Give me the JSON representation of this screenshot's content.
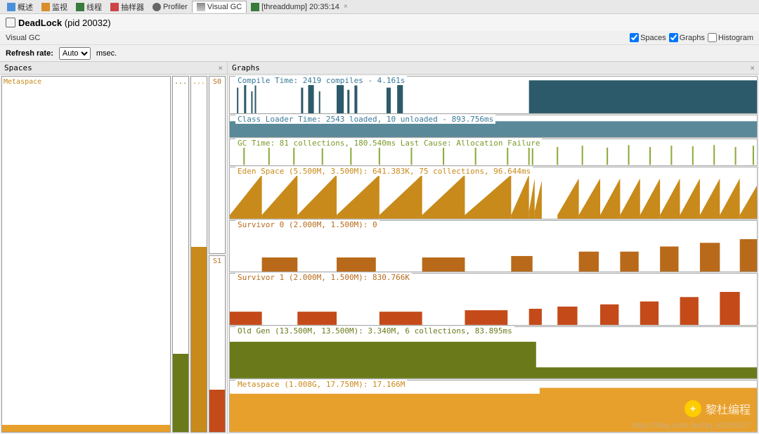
{
  "tabs": [
    {
      "label": "概述",
      "icon": "overview-icon"
    },
    {
      "label": "监视",
      "icon": "monitor-icon"
    },
    {
      "label": "线程",
      "icon": "threads-icon"
    },
    {
      "label": "抽样器",
      "icon": "sampler-icon"
    },
    {
      "label": "Profiler",
      "icon": "profiler-icon"
    },
    {
      "label": "Visual GC",
      "icon": "visualgc-icon",
      "active": true
    },
    {
      "label": "[threaddump] 20:35:14",
      "icon": "threaddump-icon",
      "closable": true
    }
  ],
  "title": {
    "app": "DeadLock",
    "pid_label": "(pid 20032)"
  },
  "subtitle": "Visual GC",
  "checkboxes": {
    "spaces": {
      "label": "Spaces",
      "checked": true
    },
    "graphs": {
      "label": "Graphs",
      "checked": true
    },
    "histogram": {
      "label": "Histogram",
      "checked": false
    }
  },
  "refresh": {
    "label": "Refresh rate:",
    "value": "Auto",
    "unit": "msec."
  },
  "spaces_panel": {
    "title": "Spaces"
  },
  "graphs_panel": {
    "title": "Graphs"
  },
  "spaces": {
    "metaspace": {
      "label": "Metaspace",
      "color": "#e8a02c",
      "fill_pct": 2
    },
    "old": {
      "label": "...",
      "color": "#6a7a1a",
      "fill_pct": 22
    },
    "eden": {
      "label": "...",
      "color": "#c88a1a",
      "fill_pct": 52
    },
    "s0": {
      "label": "S0",
      "color": "#b86a1a",
      "fill_pct": 0
    },
    "s1": {
      "label": "S1",
      "color": "#c44a1a",
      "fill_pct": 12
    }
  },
  "graphs": {
    "compile": {
      "label": "Compile Time: 2419 compiles - 4.161s",
      "color": "#2d5a6a"
    },
    "classloader": {
      "label": "Class Loader Time: 2543 loaded, 10 unloaded - 893.756ms",
      "color": "#5a8a9a"
    },
    "gc": {
      "label": "GC Time: 81 collections, 180.540ms Last Cause: Allocation Failure",
      "color": "#8aaa3a"
    },
    "eden": {
      "label": "Eden Space (5.500M, 3.500M): 641.383K, 75 collections, 96.644ms",
      "color": "#c88a1a"
    },
    "s0": {
      "label": "Survivor 0 (2.000M, 1.500M): 0",
      "color": "#b86a1a"
    },
    "s1": {
      "label": "Survivor 1 (2.000M, 1.500M): 830.766K",
      "color": "#c44a1a"
    },
    "oldgen": {
      "label": "Old Gen (13.500M, 13.500M): 3.340M, 6 collections, 83.895ms",
      "color": "#6a7a1a"
    },
    "metaspace": {
      "label": "Metaspace (1.008G, 17.750M): 17.166M",
      "color": "#e8a02c"
    }
  },
  "watermark": {
    "text": "黎杜编程",
    "url": "https://blog.csdn.net/qq_43255017"
  },
  "chart_data": [
    {
      "type": "bar",
      "name": "compile",
      "title": "Compile Time",
      "series": "spikes",
      "count": 2419,
      "total_seconds": 4.161
    },
    {
      "type": "area",
      "name": "classloader",
      "title": "Class Loader Time",
      "loaded": 2543,
      "unloaded": 10,
      "total_ms": 893.756,
      "fill": "full"
    },
    {
      "type": "bar",
      "name": "gc",
      "title": "GC Time",
      "collections": 81,
      "total_ms": 180.54,
      "last_cause": "Allocation Failure",
      "series": "spikes"
    },
    {
      "type": "area",
      "name": "eden",
      "title": "Eden Space",
      "max_mb": 5.5,
      "committed_mb": 3.5,
      "used_kb": 641.383,
      "collections": 75,
      "time_ms": 96.644,
      "pattern": "sawtooth",
      "cycles": 20
    },
    {
      "type": "area",
      "name": "survivor0",
      "title": "Survivor 0",
      "max_mb": 2.0,
      "committed_mb": 1.5,
      "used": 0,
      "pattern": "pulses"
    },
    {
      "type": "area",
      "name": "survivor1",
      "title": "Survivor 1",
      "max_mb": 2.0,
      "committed_mb": 1.5,
      "used_kb": 830.766,
      "pattern": "pulses"
    },
    {
      "type": "area",
      "name": "oldgen",
      "title": "Old Gen",
      "max_mb": 13.5,
      "committed_mb": 13.5,
      "used_mb": 3.34,
      "collections": 6,
      "time_ms": 83.895,
      "pattern": "step"
    },
    {
      "type": "area",
      "name": "metaspace",
      "title": "Metaspace",
      "max_gb": 1.008,
      "committed_mb": 17.75,
      "used_mb": 17.166,
      "pattern": "step"
    }
  ]
}
